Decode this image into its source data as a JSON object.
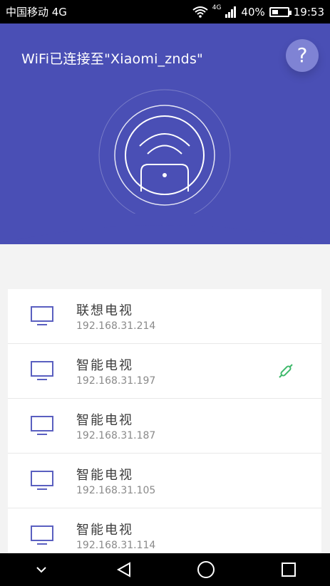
{
  "status_bar": {
    "carrier": "中国移动 4G",
    "network": "4G",
    "battery": "40%",
    "battery_level": 0.4,
    "time": "19:53"
  },
  "header": {
    "title": "WiFi已连接至\"Xiaomi_znds\"",
    "help_label": "?",
    "accent_color": "#4a4fb5"
  },
  "devices": [
    {
      "name": "联想电视",
      "ip": "192.168.31.214",
      "connected": false
    },
    {
      "name": "智能电视",
      "ip": "192.168.31.197",
      "connected": true
    },
    {
      "name": "智能电视",
      "ip": "192.168.31.187",
      "connected": false
    },
    {
      "name": "智能电视",
      "ip": "192.168.31.105",
      "connected": false
    },
    {
      "name": "智能电视",
      "ip": "192.168.31.114",
      "connected": false
    }
  ],
  "icons": {
    "device": "tv-icon",
    "link": "link-icon",
    "nav": [
      "chevron-down-icon",
      "back-icon",
      "home-icon",
      "recents-icon"
    ]
  }
}
